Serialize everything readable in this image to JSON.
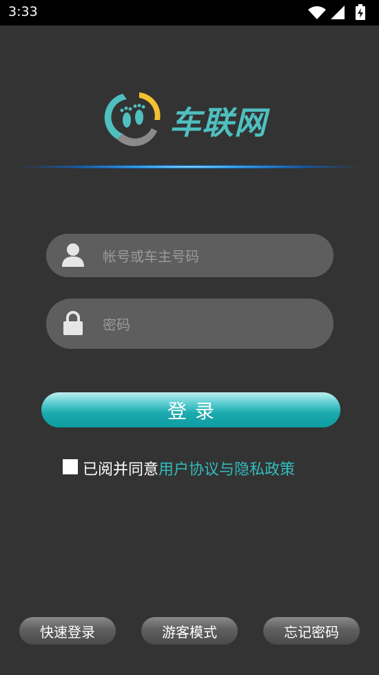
{
  "status_bar": {
    "time": "3:33",
    "icons": [
      "wifi-icon",
      "signal-icon",
      "battery-charging-icon"
    ]
  },
  "logo": {
    "text": "车联网",
    "icon": "footprints-logo-icon",
    "colors": {
      "teal": "#4fbfbf",
      "yellow": "#f2c230",
      "gray": "#8a8a8a"
    }
  },
  "form": {
    "account": {
      "placeholder": "帐号或车主号码",
      "value": "",
      "icon": "user-icon"
    },
    "password": {
      "placeholder": "密码",
      "value": "",
      "icon": "lock-icon"
    },
    "login_label": "登录"
  },
  "agreement": {
    "checked": false,
    "text": "已阅并同意",
    "link": "用户协议与隐私政策"
  },
  "bottom_actions": {
    "quick_login": "快速登录",
    "guest_mode": "游客模式",
    "forgot_password": "忘记密码"
  },
  "colors": {
    "background": "#333333",
    "accent": "#1aa9ad",
    "link": "#33bcbc",
    "field": "#5e5e5e"
  }
}
